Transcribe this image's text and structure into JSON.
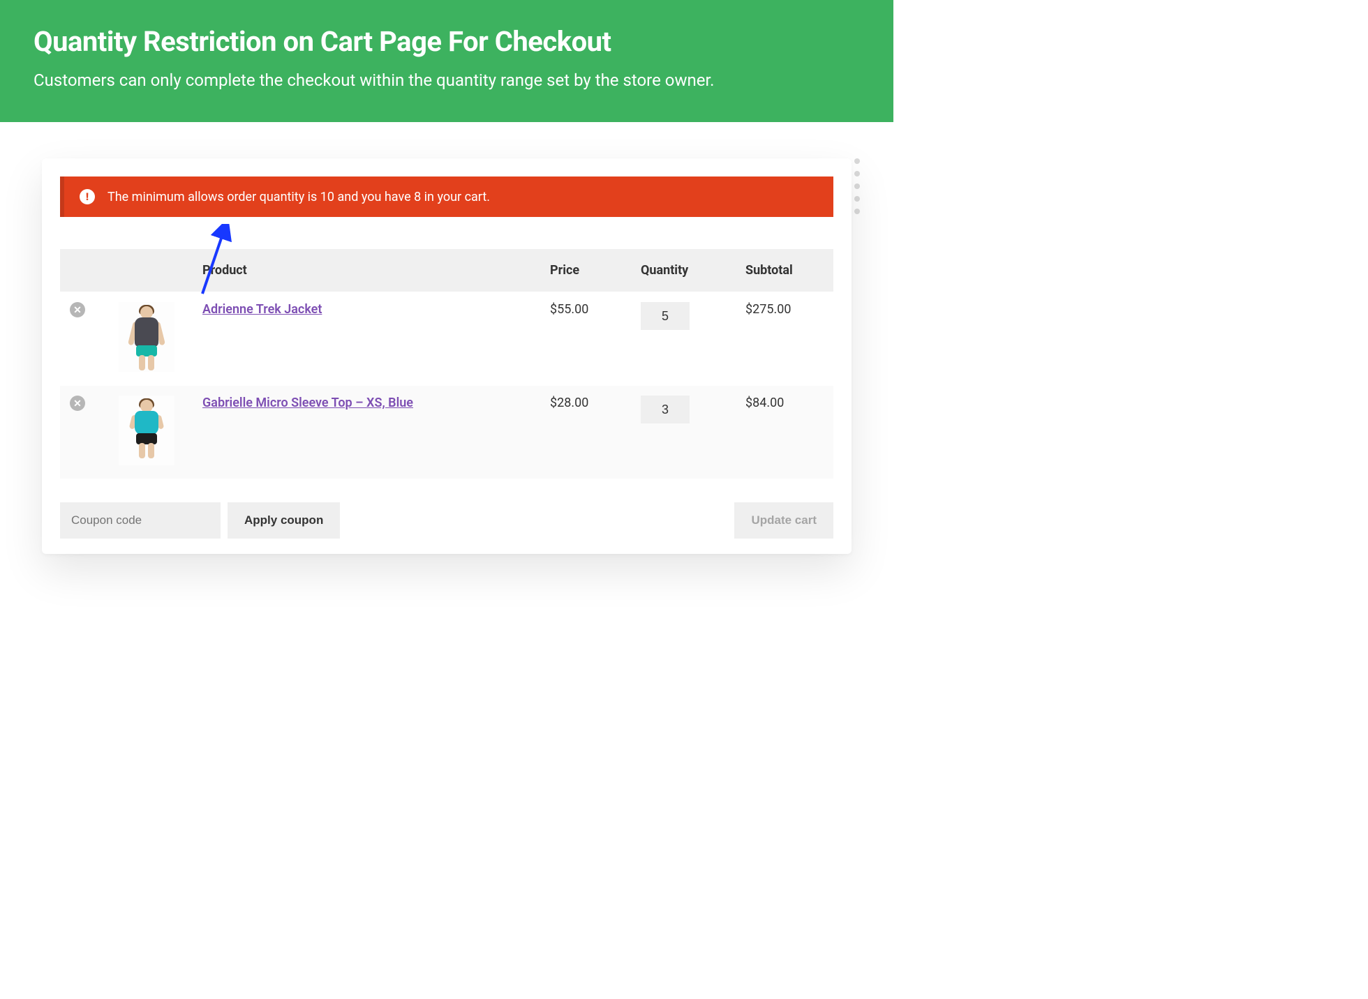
{
  "hero": {
    "title": "Quantity Restriction on Cart Page For Checkout",
    "subtitle": "Customers can only complete the checkout within the quantity range set by the store owner."
  },
  "notice": {
    "icon_glyph": "!",
    "text": "The minimum allows order quantity is 10 and you have 8 in your cart."
  },
  "table": {
    "headers": {
      "product": "Product",
      "price": "Price",
      "quantity": "Quantity",
      "subtotal": "Subtotal"
    }
  },
  "items": [
    {
      "name": "Adrienne Trek Jacket",
      "price": "$55.00",
      "quantity": "5",
      "subtotal": "$275.00"
    },
    {
      "name": "Gabrielle Micro Sleeve Top – XS, Blue",
      "price": "$28.00",
      "quantity": "3",
      "subtotal": "$84.00"
    }
  ],
  "actions": {
    "coupon_placeholder": "Coupon code",
    "apply_coupon": "Apply coupon",
    "update_cart": "Update cart"
  }
}
